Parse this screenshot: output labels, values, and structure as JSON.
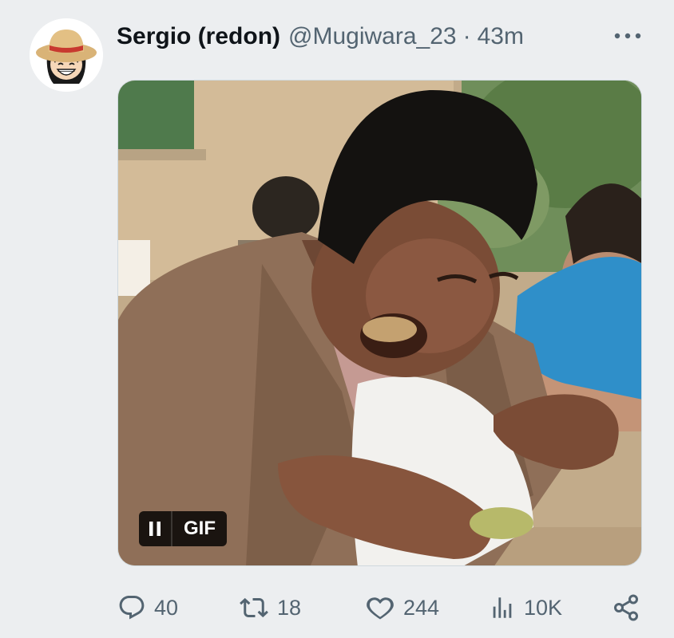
{
  "tweet": {
    "author": {
      "display_name": "Sergio (redon)",
      "handle": "@Mugiwara_23",
      "separator": "·",
      "time": "43m",
      "avatar_icon": "straw-hat-avatar-icon"
    },
    "menu_icon": "more-dots-icon",
    "media": {
      "type": "gif",
      "badge_label": "GIF",
      "control_icon": "pause-icon"
    },
    "actions": {
      "reply": {
        "icon": "reply-icon",
        "count": "40"
      },
      "retweet": {
        "icon": "retweet-icon",
        "count": "18"
      },
      "like": {
        "icon": "heart-icon",
        "count": "244"
      },
      "views": {
        "icon": "views-chart-icon",
        "count": "10K"
      },
      "share": {
        "icon": "share-icon"
      }
    }
  },
  "colors": {
    "background": "#eceef0",
    "text_primary": "#0f1419",
    "text_secondary": "#536471"
  }
}
